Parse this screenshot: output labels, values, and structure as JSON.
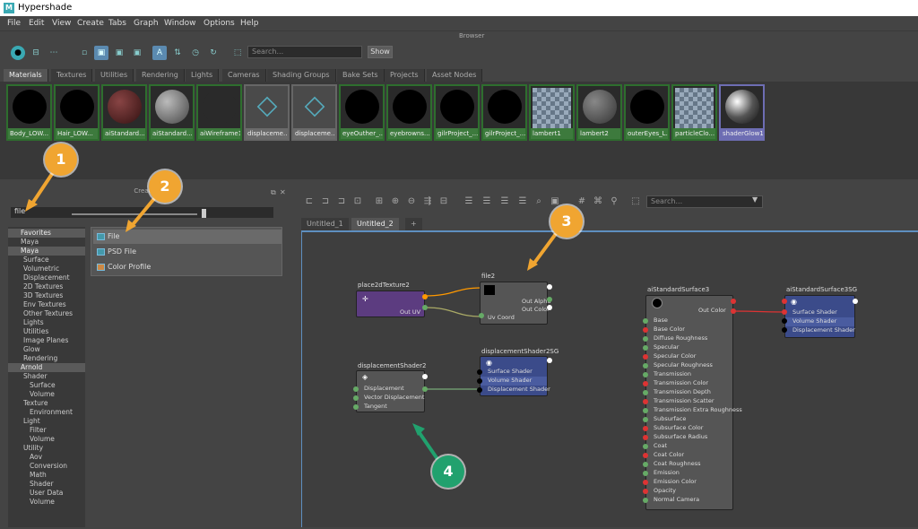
{
  "window": {
    "title": "Hypershade",
    "logo": "M"
  },
  "menu": [
    "File",
    "Edit",
    "View",
    "Create",
    "Tabs",
    "Graph",
    "Window",
    "Options",
    "Help"
  ],
  "browser": {
    "header": "Browser",
    "search_placeholder": "Search...",
    "show_label": "Show"
  },
  "browser_tabs": [
    "Materials",
    "Textures",
    "Utilities",
    "Rendering",
    "Lights",
    "Cameras",
    "Shading Groups",
    "Bake Sets",
    "Projects",
    "Asset Nodes"
  ],
  "swatches": [
    "Body_LOW...",
    "Hair_LOW...",
    "aiStandard...",
    "aiStandard...",
    "aiWireframe1",
    "displaceme...",
    "displaceme...",
    "eyeOuther_...",
    "eyebrowns...",
    "gilrProject_...",
    "gilrProject_...",
    "lambert1",
    "lambert2",
    "outerEyes_L...",
    "particleClo...",
    "shaderGlow1"
  ],
  "create": {
    "header": "Create",
    "search_value": "file",
    "tree": [
      "Favorites",
      "Maya",
      "Maya",
      "Surface",
      "Volumetric",
      "Displacement",
      "2D Textures",
      "3D Textures",
      "Env Textures",
      "Other Textures",
      "Lights",
      "Utilities",
      "Image Planes",
      "Glow",
      "Rendering",
      "Arnold",
      "Shader",
      "Surface",
      "Volume",
      "Texture",
      "Environment",
      "Light",
      "Filter",
      "Volume",
      "Utility",
      "Aov",
      "Conversion",
      "Math",
      "Shader",
      "User Data",
      "Volume"
    ],
    "items": [
      "File",
      "PSD File",
      "Color Profile"
    ]
  },
  "editor": {
    "search_placeholder": "Search...",
    "tabs": [
      "Untitled_1",
      "Untitled_2",
      "+"
    ]
  },
  "nodes": {
    "place2d": {
      "title": "place2dTexture2",
      "rows": [
        "Out UV"
      ]
    },
    "file2": {
      "title": "file2",
      "rows": [
        "Out Alpha",
        "Out Color",
        "Uv Coord"
      ]
    },
    "dispSG": {
      "title": "displacementShader2SG",
      "rows": [
        "Surface Shader",
        "Volume Shader",
        "Displacement Shader"
      ]
    },
    "disp": {
      "title": "displacementShader2",
      "rows": [
        "Displacement",
        "Vector Displacement",
        "Tangent"
      ]
    },
    "ai3": {
      "title": "aiStandardSurface3",
      "rows": [
        "Out Color",
        "Base",
        "Base Color",
        "Diffuse Roughness",
        "Specular",
        "Specular Color",
        "Specular Roughness",
        "Transmission",
        "Transmission Color",
        "Transmission Depth",
        "Transmission Scatter",
        "Transmission Extra Roughness",
        "Subsurface",
        "Subsurface Color",
        "Subsurface Radius",
        "Coat",
        "Coat Color",
        "Coat Roughness",
        "Emission",
        "Emission Color",
        "Opacity",
        "Normal Camera"
      ]
    },
    "ai3SG": {
      "title": "aiStandardSurface3SG",
      "rows": [
        "Surface Shader",
        "Volume Shader",
        "Displacement Shader"
      ]
    }
  },
  "callouts": [
    "1",
    "2",
    "3",
    "4"
  ],
  "colors": {
    "accent": "#f0a531",
    "accent2": "#21a16e",
    "selection": "#5e8fc0"
  }
}
